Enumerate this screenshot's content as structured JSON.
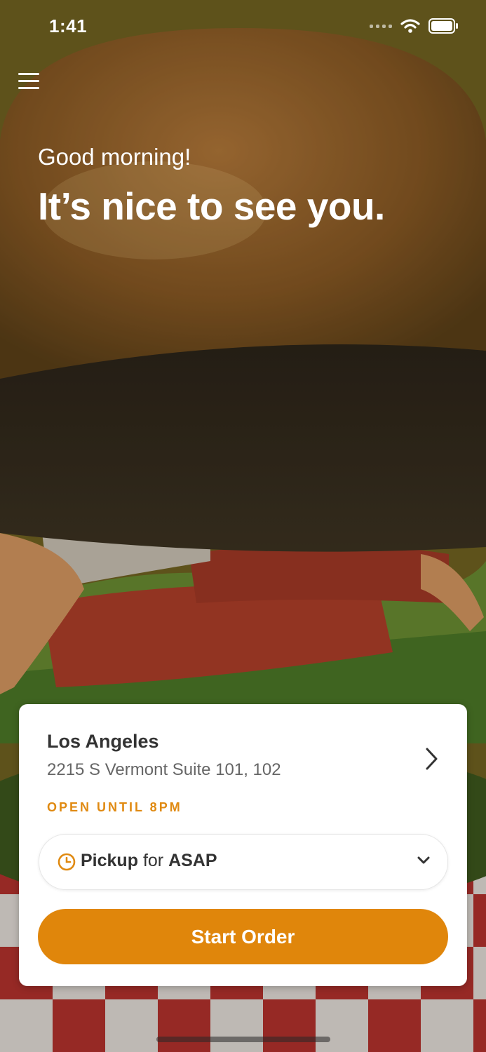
{
  "status_bar": {
    "time": "1:41"
  },
  "hero": {
    "greeting": "Good morning!",
    "headline": "It’s nice to see you."
  },
  "location": {
    "name": "Los Angeles",
    "address": "2215 S Vermont Suite 101, 102",
    "hours": "OPEN UNTIL 8PM"
  },
  "pickup": {
    "mode": "Pickup",
    "connector": "for",
    "time": "ASAP"
  },
  "start_order_label": "Start Order",
  "colors": {
    "accent": "#e0860b",
    "hours_text": "#e08a12"
  },
  "icons": [
    "menu-icon",
    "chevron-right-icon",
    "clock-icon",
    "chevron-down-icon",
    "wifi-icon",
    "battery-icon",
    "signal-icon"
  ]
}
